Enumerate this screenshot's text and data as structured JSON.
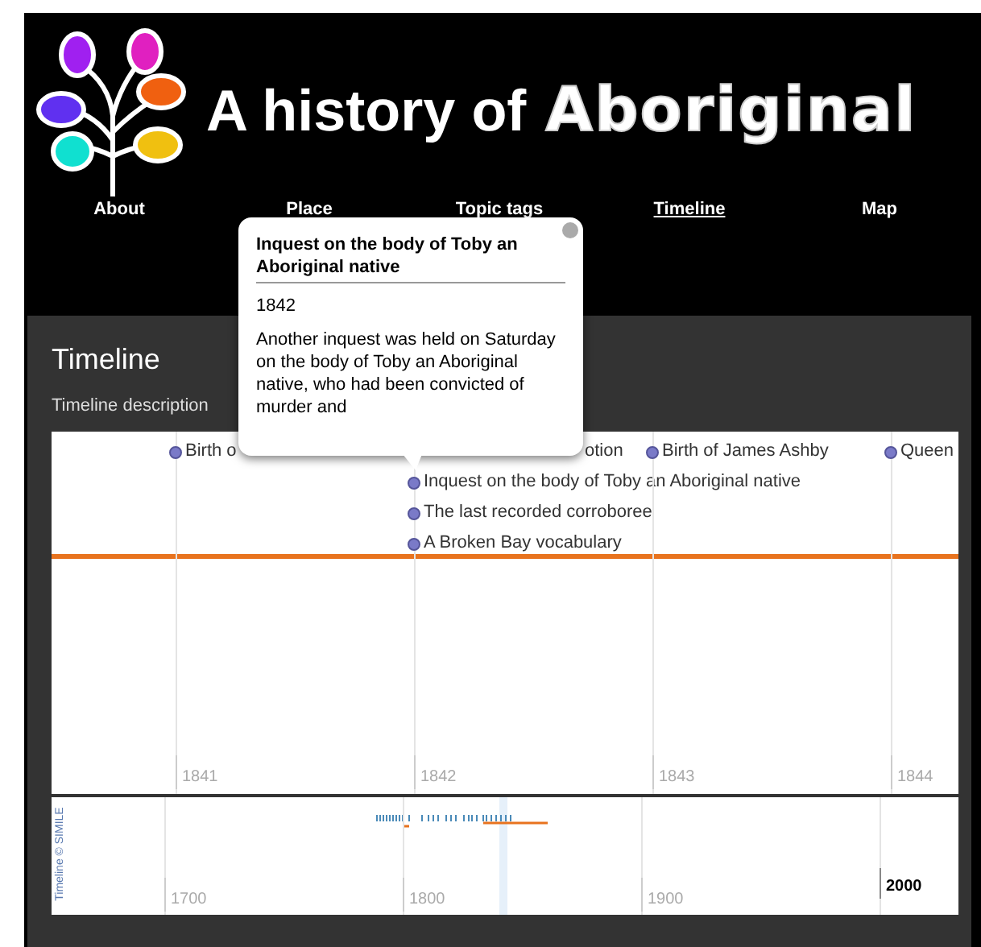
{
  "header": {
    "title": "A history of",
    "title_highlight": "Aboriginal"
  },
  "nav": [
    {
      "label": "About",
      "selected": false
    },
    {
      "label": "Place",
      "selected": false
    },
    {
      "label": "Topic tags",
      "selected": false
    },
    {
      "label": "Timeline",
      "selected": true
    },
    {
      "label": "Map",
      "selected": false
    }
  ],
  "panel": {
    "title": "Timeline",
    "description": "Timeline description"
  },
  "timeline": {
    "columns": [
      {
        "label": "1841",
        "events": [
          {
            "kind": "event",
            "label": "Birth o"
          }
        ]
      },
      {
        "label": "1842",
        "events": [
          {
            "kind": "partial",
            "label": "otion"
          },
          {
            "kind": "event",
            "label": "Inquest on the body of Toby an Aboriginal native"
          },
          {
            "kind": "event",
            "label": "The last recorded corroboree"
          },
          {
            "kind": "event",
            "label": "A Broken Bay vocabulary"
          }
        ]
      },
      {
        "label": "1843",
        "events": [
          {
            "kind": "event",
            "label": "Birth of James Ashby"
          }
        ]
      },
      {
        "label": "1844",
        "events": [
          {
            "kind": "event",
            "label": "Queen"
          }
        ]
      }
    ],
    "overview": {
      "credit": "Timeline © SIMILE",
      "columns": [
        {
          "label": "1700",
          "selected": false
        },
        {
          "label": "1800",
          "selected": false
        },
        {
          "label": "1900",
          "selected": false
        },
        {
          "label": "2000",
          "selected": true
        }
      ]
    }
  },
  "popup": {
    "title": "Inquest on the body of Toby an Aboriginal native",
    "date": "1842",
    "text": "Another inquest was held on Saturday on the body of Toby an Aboriginal native, who had been convicted of murder and"
  }
}
